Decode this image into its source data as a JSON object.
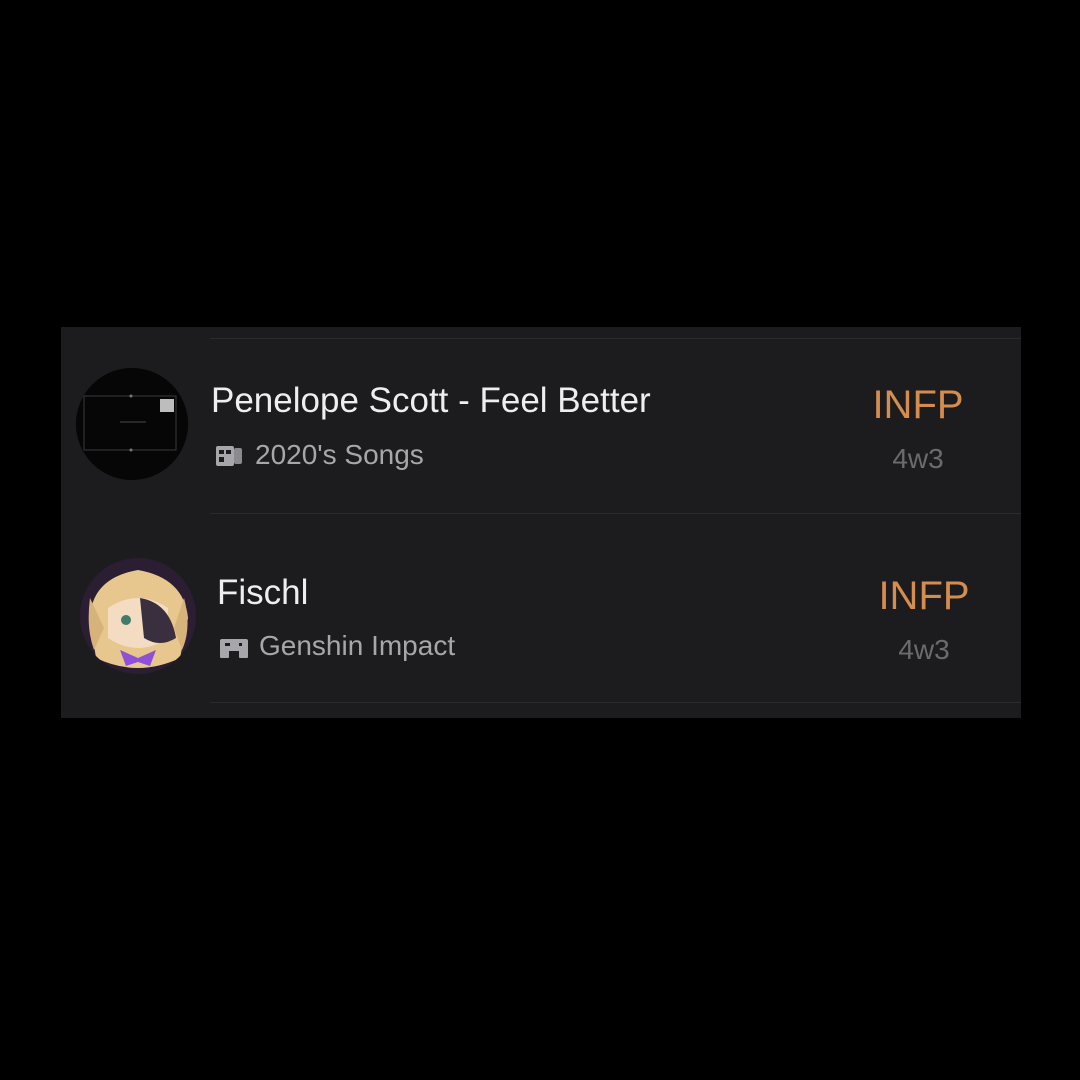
{
  "rows": [
    {
      "title": "Penelope Scott - Feel Better",
      "category": "2020's Songs",
      "category_icon": "music-album-icon",
      "personality_type": "INFP",
      "enneagram": "4w3"
    },
    {
      "title": "Fischl",
      "category": "Genshin Impact",
      "category_icon": "gamepad-icon",
      "personality_type": "INFP",
      "enneagram": "4w3"
    }
  ],
  "colors": {
    "background": "#000000",
    "panel": "#1c1c1e",
    "title": "#eeeeee",
    "subtitle": "#a7a7ab",
    "accent": "#d48d4f",
    "muted": "#6b6b6f"
  }
}
